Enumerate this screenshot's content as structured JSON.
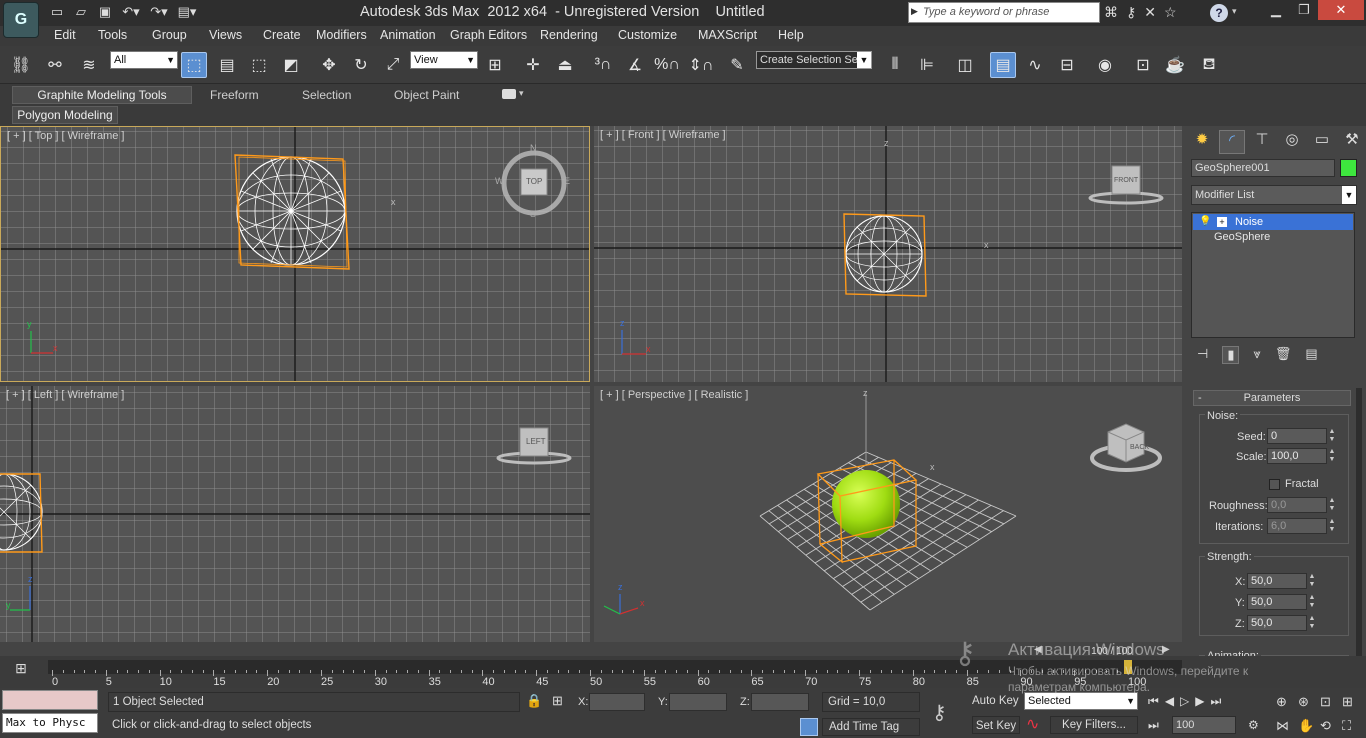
{
  "titlebar": {
    "app_title": "Autodesk 3ds Max  2012 x64  - Unregistered Version    Untitled",
    "search_placeholder": "Type a keyword or phrase",
    "app_icon": "3dsmax-logo-icon",
    "quick_access": [
      "new-icon",
      "open-icon",
      "save-icon",
      "undo-icon",
      "redo-icon",
      "project-icon"
    ],
    "window_buttons": [
      "minimize-icon",
      "restore-icon",
      "close-icon"
    ]
  },
  "menu": [
    "Edit",
    "Tools",
    "Group",
    "Views",
    "Create",
    "Modifiers",
    "Animation",
    "Graph Editors",
    "Rendering",
    "Customize",
    "MAXScript",
    "Help"
  ],
  "toolbar": {
    "filter_value": "All",
    "refcoord_value": "View",
    "selection_set_placeholder": "Create Selection Se"
  },
  "ribbon": {
    "tabs": [
      "Graphite Modeling Tools",
      "Freeform",
      "Selection",
      "Object Paint"
    ],
    "subtab": "Polygon Modeling"
  },
  "viewports": {
    "top": "[ + ] [ Top ] [ Wireframe ]",
    "front": "[ + ] [ Front ] [ Wireframe ]",
    "left": "[ + ] [ Left ] [ Wireframe ]",
    "perspective": "[ + ] [ Perspective ] [ Realistic ]",
    "cube_top": "TOP",
    "cube_front": "FRONT",
    "cube_left": "LEFT",
    "cube_persp": "BACK",
    "compass_labels": [
      "N",
      "W",
      "E",
      "S"
    ],
    "axis_x": "x",
    "axis_y": "y",
    "axis_z": "z"
  },
  "command_panel": {
    "tabs": [
      "create-icon",
      "modify-icon",
      "hierarchy-icon",
      "motion-icon",
      "display-icon",
      "utilities-icon"
    ],
    "object_name": "GeoSphere001",
    "object_color": "#3ee63e",
    "modifier_list": "Modifier List",
    "stack": [
      "Noise",
      "GeoSphere"
    ],
    "rollout_title": "Parameters",
    "rollout_sign": "-",
    "noise_group": "Noise:",
    "seed_label": "Seed:",
    "seed": "0",
    "scale_label": "Scale:",
    "scale": "100,0",
    "fractal_label": "Fractal",
    "roughness_label": "Roughness:",
    "roughness": "0,0",
    "iterations_label": "Iterations:",
    "iterations": "6,0",
    "strength_group": "Strength:",
    "x_label": "X:",
    "strength_x": "50,0",
    "y_label": "Y:",
    "strength_y": "50,0",
    "z_label": "Z:",
    "strength_z": "50,0",
    "animation_group": "Animation:"
  },
  "timeline": {
    "frame_counter": "100 / 100",
    "ticks": [
      "0",
      "5",
      "10",
      "15",
      "20",
      "25",
      "30",
      "35",
      "40",
      "45",
      "50",
      "55",
      "60",
      "65",
      "70",
      "75",
      "80",
      "85",
      "90",
      "95",
      "100"
    ],
    "slider_position": 1.0
  },
  "status": {
    "script_listener": "Max to Physc",
    "selection_count": "1 Object Selected",
    "prompt": "Click or click-and-drag to select objects",
    "x_label": "X:",
    "y_label": "Y:",
    "z_label": "Z:",
    "grid": "Grid = 10,0",
    "add_time_tag": "Add Time Tag",
    "auto_key": "Auto Key",
    "set_key": "Set Key",
    "selected_dropdown": "Selected",
    "key_filters": "Key Filters...",
    "current_frame": "100"
  },
  "watermark": {
    "line1": "Активация Windows",
    "line2": "Чтобы активировать Windows, перейдите к",
    "line3": "параметрам компьютера."
  }
}
